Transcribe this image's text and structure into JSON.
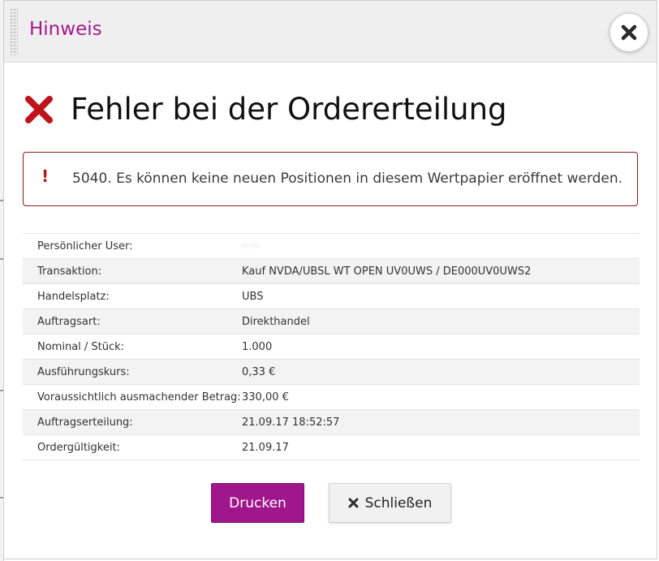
{
  "dialog": {
    "title": "Hinweis"
  },
  "error": {
    "title": "Fehler bei der Ordererteilung",
    "alert_mark": "!",
    "message": "5040. Es können keine neuen Positionen in diesem Wertpapier eröffnet werden."
  },
  "details": [
    {
      "label": "Persönlicher User:",
      "value": "·· ··"
    },
    {
      "label": "Transaktion:",
      "value": "Kauf NVDA/UBSL WT OPEN UV0UWS / DE000UV0UWS2"
    },
    {
      "label": "Handelsplatz:",
      "value": "UBS"
    },
    {
      "label": "Auftragsart:",
      "value": "Direkthandel"
    },
    {
      "label": "Nominal / Stück:",
      "value": "1.000"
    },
    {
      "label": "Ausführungskurs:",
      "value": "0,33 €"
    },
    {
      "label": "Voraussichtlich ausmachender Betrag:",
      "value": "330,00 €"
    },
    {
      "label": "Auftragserteilung:",
      "value": "21.09.17 18:52:57"
    },
    {
      "label": "Ordergültigkeit:",
      "value": "21.09.17"
    }
  ],
  "buttons": {
    "print_label": "Drucken",
    "close_label": "Schließen"
  },
  "colors": {
    "brand": "#a3198e",
    "error": "#b01818",
    "alert_border": "#8a1a1a"
  },
  "icons": {
    "dialog_close": "close-icon",
    "error": "error-x-icon",
    "close_button": "close-icon"
  }
}
